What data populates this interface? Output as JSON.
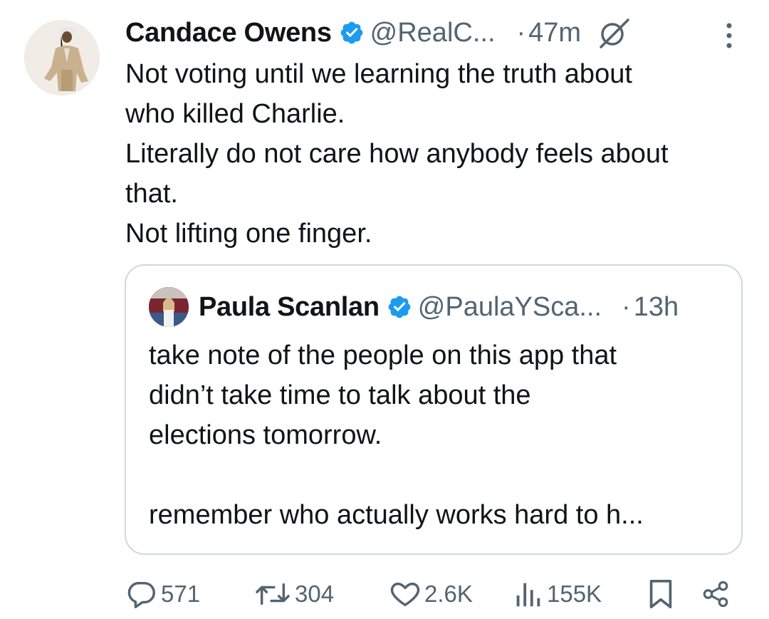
{
  "tweet": {
    "author_name": "Candace Owens",
    "handle": "@RealC...",
    "time_separator": "·",
    "time": "47m",
    "text_lines": [
      "Not voting until we learning the truth about",
      "who killed Charlie.",
      "Literally do not care how anybody feels about",
      "that.",
      "Not lifting one finger."
    ]
  },
  "quoted_tweet": {
    "author_name": "Paula Scanlan",
    "handle": "@PaulaYSca...",
    "time_separator": "·",
    "time": "13h",
    "text_lines": [
      "take note of the people on this app that",
      "didn’t take time to talk about the",
      "elections tomorrow.",
      "",
      "remember who actually works hard to h..."
    ]
  },
  "actions": {
    "replies": "571",
    "reposts": "304",
    "likes": "2.6K",
    "views": "155K"
  },
  "icons": {
    "verified": "verified-badge-icon",
    "grok": "grok-icon",
    "more": "more-vertical-icon",
    "reply": "reply-icon",
    "repost": "repost-icon",
    "like": "heart-icon",
    "views": "views-icon",
    "bookmark": "bookmark-icon",
    "share": "share-icon"
  },
  "colors": {
    "verified": "#1d9bf0",
    "text_primary": "#0f1419",
    "text_secondary": "#536471",
    "border": "#cfd9de"
  }
}
